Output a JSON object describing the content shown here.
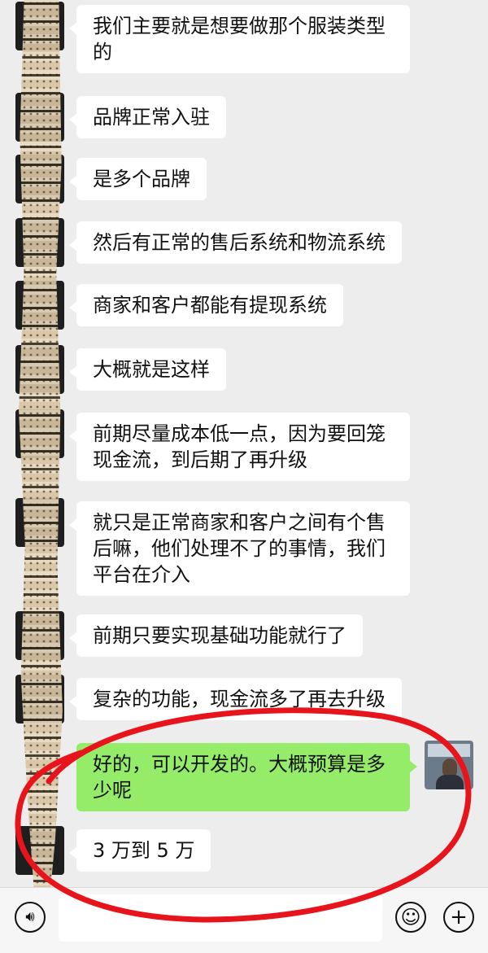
{
  "messages": [
    {
      "side": "left",
      "text": "我们主要就是想要做那个服装类型的"
    },
    {
      "side": "left",
      "text": "品牌正常入驻"
    },
    {
      "side": "left",
      "text": "是多个品牌"
    },
    {
      "side": "left",
      "text": "然后有正常的售后系统和物流系统"
    },
    {
      "side": "left",
      "text": "商家和客户都能有提现系统"
    },
    {
      "side": "left",
      "text": "大概就是这样"
    },
    {
      "side": "left",
      "text": "前期尽量成本低一点，因为要回笼现金流，到后期了再升级"
    },
    {
      "side": "left",
      "text": "就只是正常商家和客户之间有个售后嘛，他们处理不了的事情，我们平台在介入"
    },
    {
      "side": "left",
      "text": "前期只要实现基础功能就行了"
    },
    {
      "side": "left",
      "text": "复杂的功能，现金流多了再去升级"
    },
    {
      "side": "right",
      "text": "好的，可以开发的。大概预算是多少呢"
    },
    {
      "side": "left",
      "text": "3 万到 5 万"
    }
  ],
  "input_bar": {
    "voice_icon": "voice-icon",
    "emoji_icon": "emoji-icon",
    "plus_icon": "plus-icon",
    "value": ""
  },
  "colors": {
    "background": "#ededed",
    "incoming_bubble": "#ffffff",
    "outgoing_bubble": "#95ec69",
    "annotation": "#e8141c"
  }
}
